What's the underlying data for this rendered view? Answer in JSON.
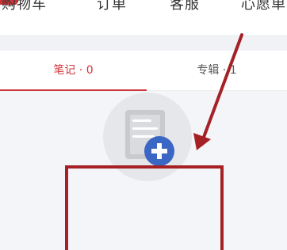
{
  "top_nav": {
    "items": [
      {
        "label": "购物车"
      },
      {
        "label": "订单"
      },
      {
        "label": "客服"
      },
      {
        "label": "心愿单"
      }
    ]
  },
  "tabs": [
    {
      "label": "笔记 · 0",
      "active": true
    },
    {
      "label": "专辑 · 1",
      "active": false
    }
  ],
  "empty_state": {
    "icon": "add-note-icon"
  },
  "annotation": {
    "arrow_icon": "pointer-arrow-icon",
    "color": "#a52125"
  },
  "colors": {
    "accent": "#d0343a",
    "badge": "#3a66c4"
  }
}
